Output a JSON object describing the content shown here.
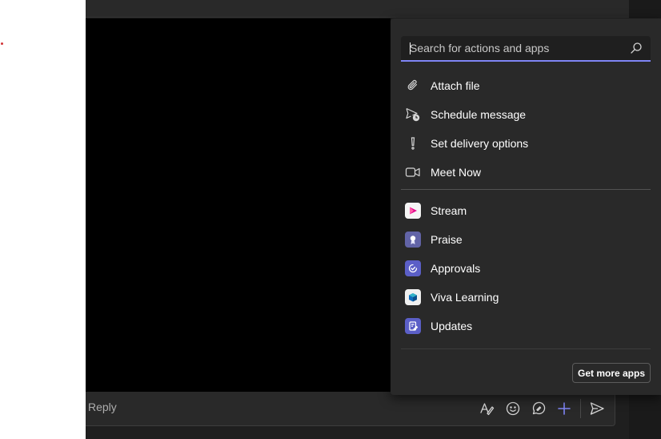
{
  "search": {
    "placeholder": "Search for actions and apps"
  },
  "actions": [
    {
      "label": "Attach file",
      "icon": "paperclip-icon"
    },
    {
      "label": "Schedule message",
      "icon": "schedule-send-icon"
    },
    {
      "label": "Set delivery options",
      "icon": "exclamation-icon"
    },
    {
      "label": "Meet Now",
      "icon": "video-camera-icon"
    }
  ],
  "apps": [
    {
      "label": "Stream",
      "icon": "stream-app-icon",
      "color": "#f5f5f5"
    },
    {
      "label": "Praise",
      "icon": "praise-app-icon",
      "color": "#6264a7"
    },
    {
      "label": "Approvals",
      "icon": "approvals-app-icon",
      "color": "#5b5fc7"
    },
    {
      "label": "Viva Learning",
      "icon": "viva-learning-app-icon",
      "color": "#f0f0f0"
    },
    {
      "label": "Updates",
      "icon": "updates-app-icon",
      "color": "#5b5fc7"
    },
    {
      "label": "",
      "icon": "app-icon",
      "color": "#5b5fc7"
    }
  ],
  "footer": {
    "more_apps_label": "Get more apps"
  },
  "compose": {
    "reply_label": "Reply"
  },
  "colors": {
    "accent": "#7f85f5",
    "panel": "#292929",
    "background": "#1f1f1f"
  }
}
